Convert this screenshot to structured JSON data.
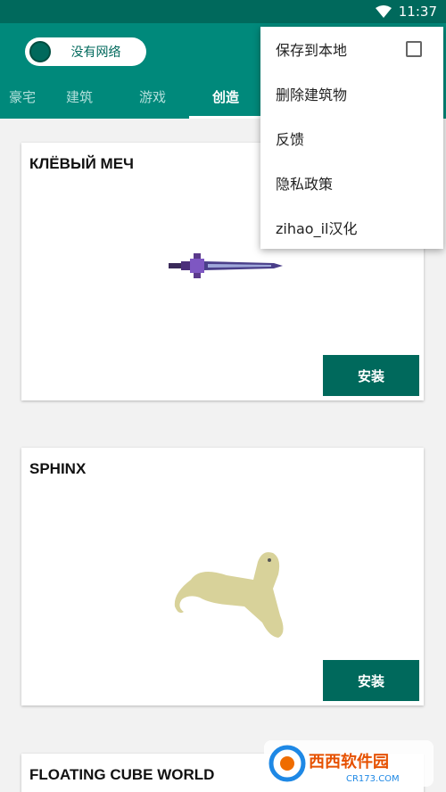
{
  "status": {
    "time": "11:37"
  },
  "toolbar": {
    "network_toggle_label": "没有网络"
  },
  "tabs": [
    {
      "label": "豪宅"
    },
    {
      "label": "建筑"
    },
    {
      "label": "游戏"
    },
    {
      "label": "创造"
    }
  ],
  "active_tab": 3,
  "cards": [
    {
      "title": "КЛЁВЫЙ МЕЧ",
      "install_label": "安装"
    },
    {
      "title": "SPHINX",
      "install_label": "安装"
    },
    {
      "title": "FLOATING CUBE WORLD"
    }
  ],
  "menu": {
    "items": [
      {
        "label": "保存到本地",
        "checked": false
      },
      {
        "label": "删除建筑物"
      },
      {
        "label": "反馈"
      },
      {
        "label": "隐私政策"
      },
      {
        "label": "zihao_il汉化"
      }
    ]
  },
  "watermark": {
    "text": "西西软件园",
    "subtext": "CR173.COM"
  },
  "colors": {
    "primary": "#00897b",
    "primary_dark": "#00695c",
    "accent_bg": "#f2f2f2"
  }
}
